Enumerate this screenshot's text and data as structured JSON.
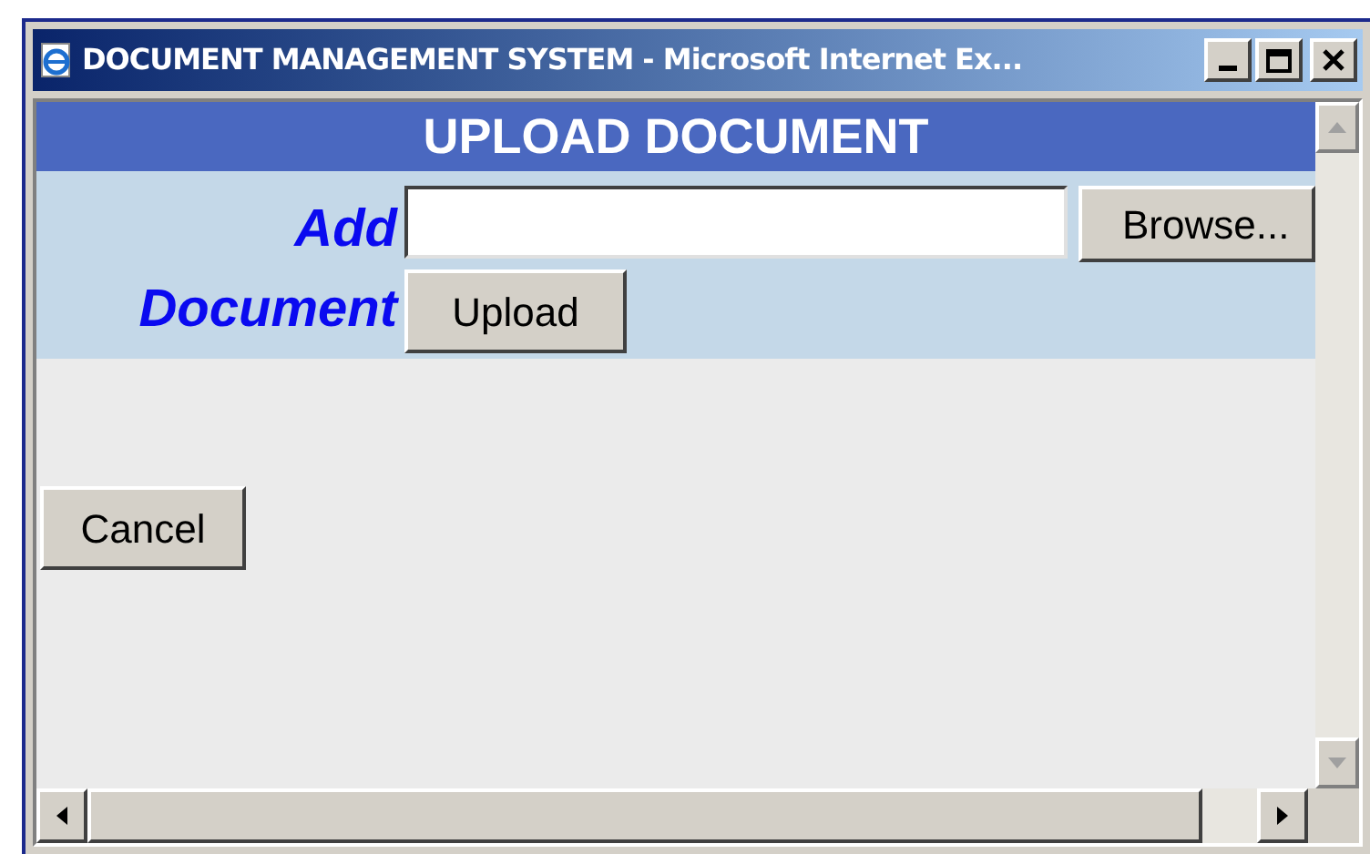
{
  "window": {
    "title": "DOCUMENT MANAGEMENT SYSTEM - Microsoft Internet Ex..."
  },
  "page": {
    "heading": "UPLOAD DOCUMENT",
    "label_line_1": "Add",
    "label_line_2": "Document",
    "browse_button": "Browse...",
    "upload_button": "Upload",
    "cancel_button": "Cancel"
  }
}
